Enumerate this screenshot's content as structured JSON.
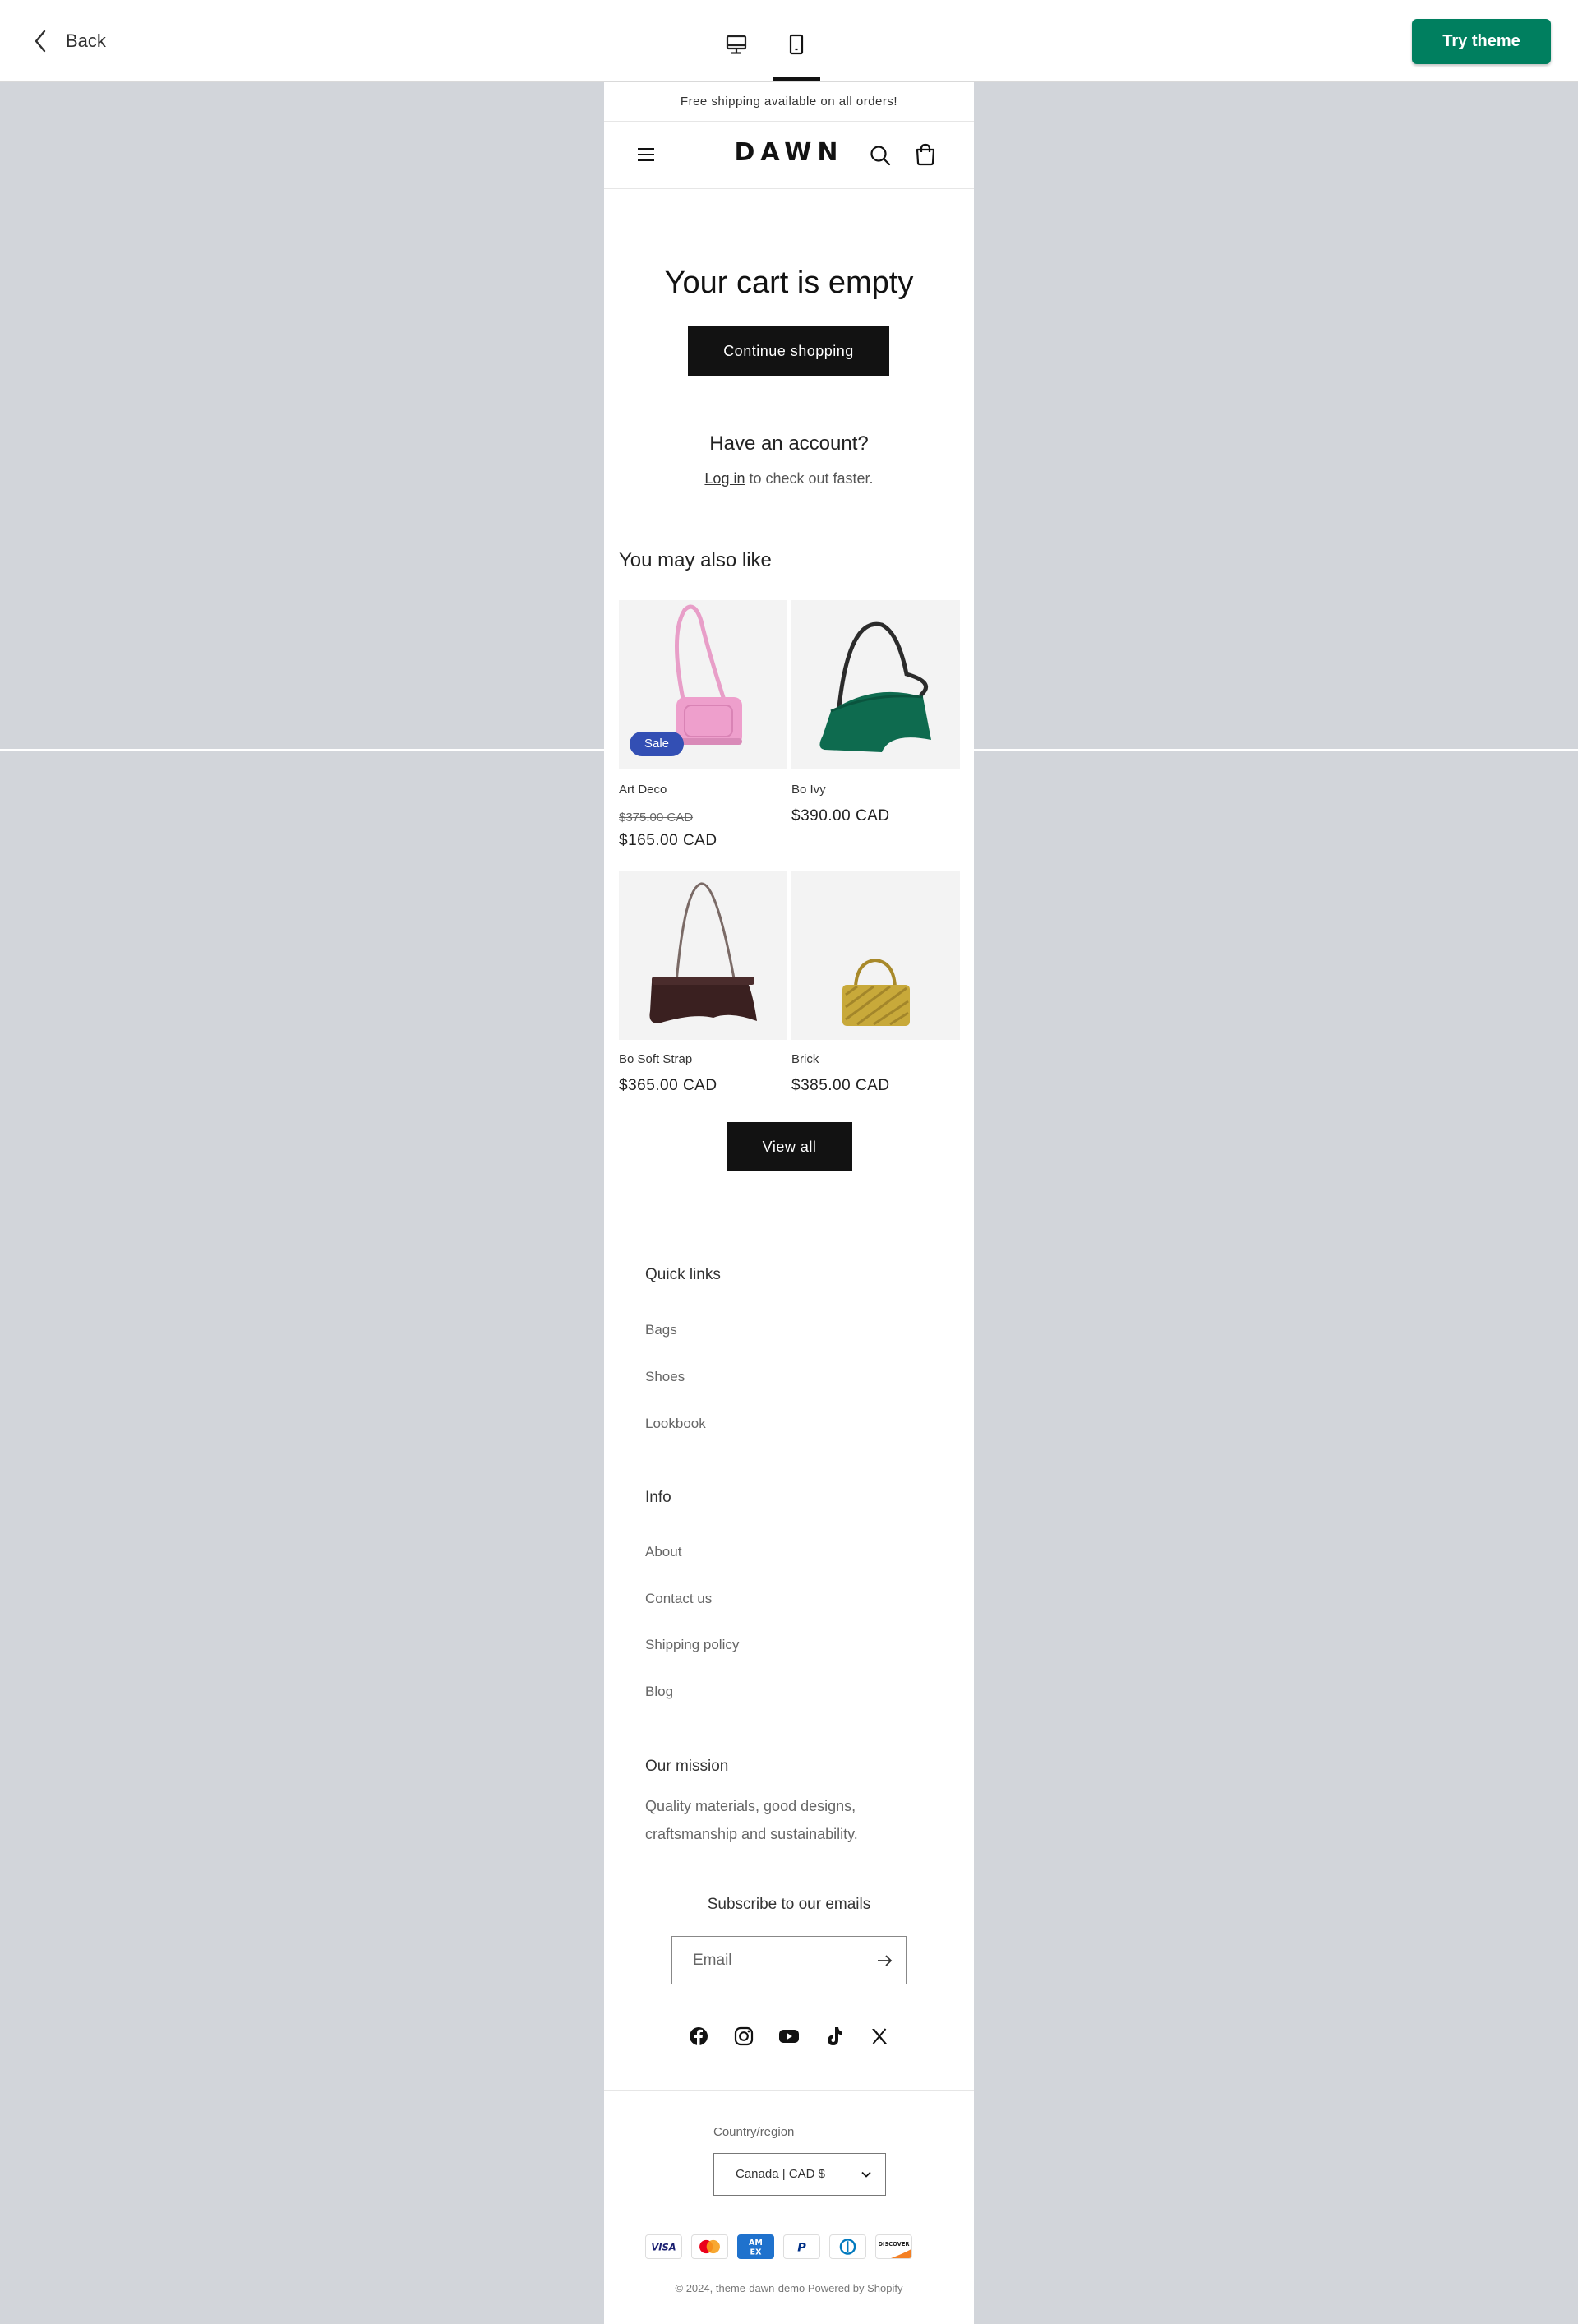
{
  "preview_bar": {
    "back_label": "Back",
    "try_label": "Try theme",
    "try_color": "#007f5f",
    "device_icons": [
      "desktop-icon",
      "mobile-icon"
    ],
    "selected_device": "mobile"
  },
  "store": {
    "announcement": "Free shipping available on all orders!",
    "logo": "DAWN",
    "header_icons": [
      "menu-icon",
      "search-icon",
      "cart-icon"
    ]
  },
  "cart": {
    "title": "Your cart is empty",
    "continue_label": "Continue shopping",
    "account_title": "Have an account?",
    "login_link": "Log in",
    "login_rest": " to check out faster."
  },
  "recommendations": {
    "title": "You may also like",
    "products": [
      {
        "name": "Art Deco",
        "old_price": "$375.00 CAD",
        "price": "$165.00 CAD",
        "badge": "Sale",
        "color": "#e89ec8"
      },
      {
        "name": "Bo Ivy",
        "price": "$390.00 CAD",
        "color": "#0e6b4f"
      },
      {
        "name": "Bo Soft Strap",
        "price": "$365.00 CAD",
        "color": "#3a2020"
      },
      {
        "name": "Brick",
        "price": "$385.00 CAD",
        "color": "#c8a93a"
      }
    ],
    "view_all_label": "View all"
  },
  "footer": {
    "quick_links_title": "Quick links",
    "quick_links": [
      "Bags",
      "Shoes",
      "Lookbook"
    ],
    "info_title": "Info",
    "info_links": [
      "About",
      "Contact us",
      "Shipping policy",
      "Blog"
    ],
    "mission_title": "Our mission",
    "mission_text": "Quality materials, good designs, craftsmanship and sustainability.",
    "subscribe_title": "Subscribe to our emails",
    "email_placeholder": "Email",
    "social_icons": [
      "facebook-icon",
      "instagram-icon",
      "youtube-icon",
      "tiktok-icon",
      "x-icon"
    ],
    "country_label": "Country/region",
    "country_value": "Canada | CAD $",
    "payment_icons": [
      "visa-icon",
      "mastercard-icon",
      "amex-icon",
      "paypal-icon",
      "diners-icon",
      "discover-icon"
    ],
    "copyright": "© 2024, theme-dawn-demo Powered by Shopify"
  }
}
